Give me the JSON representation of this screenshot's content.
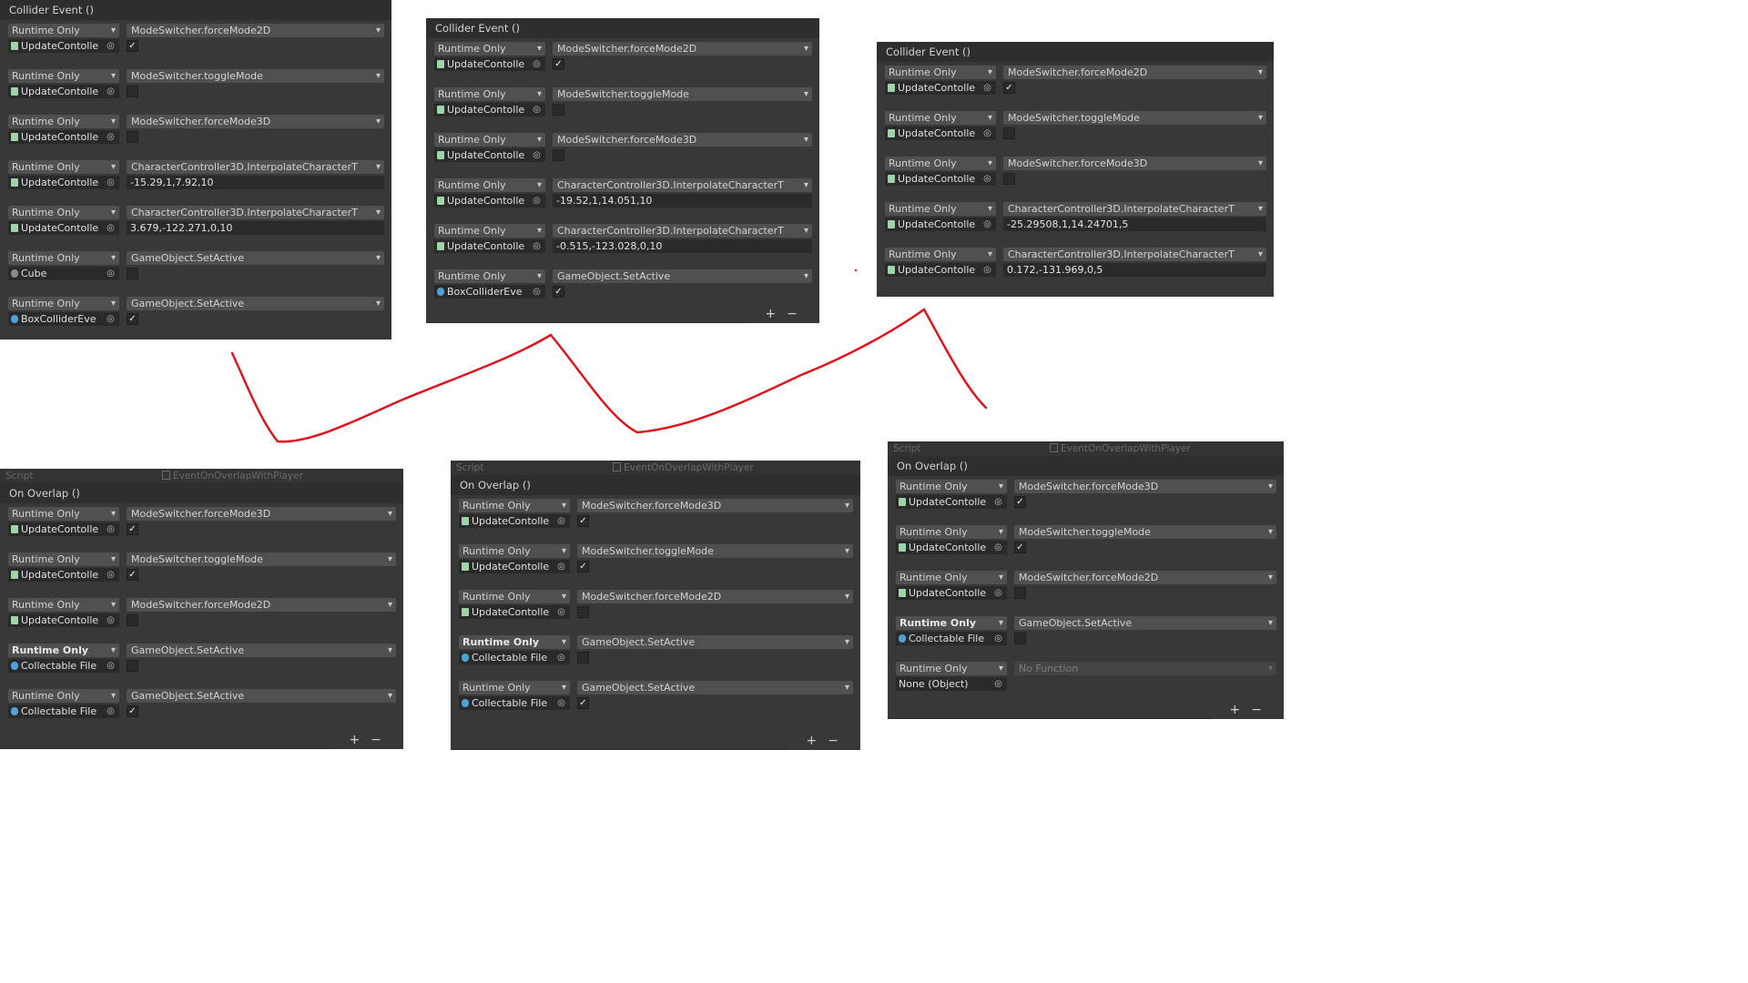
{
  "panels": [
    {
      "header": "Collider Event ()",
      "entries": [
        {
          "mode": "Runtime Only",
          "func": "ModeSwitcher.forceMode2D",
          "object": "UpdateContolle",
          "icon": "script",
          "checked": true
        },
        {
          "mode": "Runtime Only",
          "func": "ModeSwitcher.toggleMode",
          "object": "UpdateContolle",
          "icon": "script",
          "checked": false
        },
        {
          "mode": "Runtime Only",
          "func": "ModeSwitcher.forceMode3D",
          "object": "UpdateContolle",
          "icon": "script",
          "checked": false
        },
        {
          "mode": "Runtime Only",
          "func": "CharacterController3D.InterpolateCharacterT",
          "object": "UpdateContolle",
          "icon": "script",
          "arg": "-15.29,1,7.92,10"
        },
        {
          "mode": "Runtime Only",
          "func": "CharacterController3D.InterpolateCharacterT",
          "object": "UpdateContolle",
          "icon": "script",
          "arg": "3.679,-122.271,0,10"
        },
        {
          "mode": "Runtime Only",
          "func": "GameObject.SetActive",
          "object": "Cube",
          "icon": "cube",
          "checked": false
        },
        {
          "mode": "Runtime Only",
          "func": "GameObject.SetActive",
          "object": "BoxColliderEve",
          "icon": "blue",
          "checked": true
        }
      ]
    },
    {
      "header": "Collider Event ()",
      "entries": [
        {
          "mode": "Runtime Only",
          "func": "ModeSwitcher.forceMode2D",
          "object": "UpdateContolle",
          "icon": "script",
          "checked": true
        },
        {
          "mode": "Runtime Only",
          "func": "ModeSwitcher.toggleMode",
          "object": "UpdateContolle",
          "icon": "script",
          "checked": false
        },
        {
          "mode": "Runtime Only",
          "func": "ModeSwitcher.forceMode3D",
          "object": "UpdateContolle",
          "icon": "script",
          "checked": false
        },
        {
          "mode": "Runtime Only",
          "func": "CharacterController3D.InterpolateCharacterT",
          "object": "UpdateContolle",
          "icon": "script",
          "arg": "-19.52,1,14.051,10"
        },
        {
          "mode": "Runtime Only",
          "func": "CharacterController3D.InterpolateCharacterT",
          "object": "UpdateContolle",
          "icon": "script",
          "arg": "-0.515,-123.028,0,10"
        },
        {
          "mode": "Runtime Only",
          "func": "GameObject.SetActive",
          "object": "BoxColliderEve",
          "icon": "blue",
          "checked": true
        }
      ],
      "footer": {
        "add": "+",
        "remove": "−"
      }
    },
    {
      "header": "Collider Event ()",
      "entries": [
        {
          "mode": "Runtime Only",
          "func": "ModeSwitcher.forceMode2D",
          "object": "UpdateContolle",
          "icon": "script",
          "checked": true
        },
        {
          "mode": "Runtime Only",
          "func": "ModeSwitcher.toggleMode",
          "object": "UpdateContolle",
          "icon": "script",
          "checked": false
        },
        {
          "mode": "Runtime Only",
          "func": "ModeSwitcher.forceMode3D",
          "object": "UpdateContolle",
          "icon": "script",
          "checked": false
        },
        {
          "mode": "Runtime Only",
          "func": "CharacterController3D.InterpolateCharacterT",
          "object": "UpdateContolle",
          "icon": "script",
          "arg": "-25.29508,1,14.24701,5"
        },
        {
          "mode": "Runtime Only",
          "func": "CharacterController3D.InterpolateCharacterT",
          "object": "UpdateContolle",
          "icon": "script",
          "arg": "0.172,-131.969,0,5"
        }
      ]
    },
    {
      "script_label": "Script",
      "script_value": "EventOnOverlapWithPlayer",
      "header": "On Overlap ()",
      "entries": [
        {
          "mode": "Runtime Only",
          "func": "ModeSwitcher.forceMode3D",
          "object": "UpdateContolle",
          "icon": "script",
          "checked": true
        },
        {
          "mode": "Runtime Only",
          "func": "ModeSwitcher.toggleMode",
          "object": "UpdateContolle",
          "icon": "script",
          "checked": true
        },
        {
          "mode": "Runtime Only",
          "func": "ModeSwitcher.forceMode2D",
          "object": "UpdateContolle",
          "icon": "script",
          "checked": false
        },
        {
          "mode": "Runtime Only",
          "func": "GameObject.SetActive",
          "object": "Collectable File",
          "icon": "blue",
          "checked": false,
          "bold": true
        },
        {
          "mode": "Runtime Only",
          "func": "GameObject.SetActive",
          "object": "Collectable File",
          "icon": "blue",
          "checked": true
        }
      ],
      "footer": {
        "add": "+",
        "remove": "−"
      }
    },
    {
      "script_label": "Script",
      "script_value": "EventOnOverlapWithPlayer",
      "header": "On Overlap ()",
      "entries": [
        {
          "mode": "Runtime Only",
          "func": "ModeSwitcher.forceMode3D",
          "object": "UpdateContolle",
          "icon": "script",
          "checked": true
        },
        {
          "mode": "Runtime Only",
          "func": "ModeSwitcher.toggleMode",
          "object": "UpdateContolle",
          "icon": "script",
          "checked": true
        },
        {
          "mode": "Runtime Only",
          "func": "ModeSwitcher.forceMode2D",
          "object": "UpdateContolle",
          "icon": "script",
          "checked": false
        },
        {
          "mode": "Runtime Only",
          "func": "GameObject.SetActive",
          "object": "Collectable File",
          "icon": "blue",
          "checked": false,
          "bold": true
        },
        {
          "mode": "Runtime Only",
          "func": "GameObject.SetActive",
          "object": "Collectable File",
          "icon": "blue",
          "checked": true
        }
      ],
      "footer": {
        "add": "+",
        "remove": "−"
      }
    },
    {
      "script_label": "Script",
      "script_value": "EventOnOverlapWithPlayer",
      "header": "On Overlap ()",
      "entries": [
        {
          "mode": "Runtime Only",
          "func": "ModeSwitcher.forceMode3D",
          "object": "UpdateContolle",
          "icon": "script",
          "checked": true
        },
        {
          "mode": "Runtime Only",
          "func": "ModeSwitcher.toggleMode",
          "object": "UpdateContolle",
          "icon": "script",
          "checked": true
        },
        {
          "mode": "Runtime Only",
          "func": "ModeSwitcher.forceMode2D",
          "object": "UpdateContolle",
          "icon": "script",
          "checked": false
        },
        {
          "mode": "Runtime Only",
          "func": "GameObject.SetActive",
          "object": "Collectable File",
          "icon": "blue",
          "checked": false,
          "bold": true
        },
        {
          "mode": "Runtime Only",
          "func": "No Function",
          "object": "None (Object)",
          "icon": "none",
          "disabled": true
        }
      ],
      "footer": {
        "add": "+",
        "remove": "−"
      }
    }
  ],
  "colors": {
    "panel_bg": "#383838",
    "header_bg": "#2e2e2e",
    "scribble": "#e0141c"
  }
}
